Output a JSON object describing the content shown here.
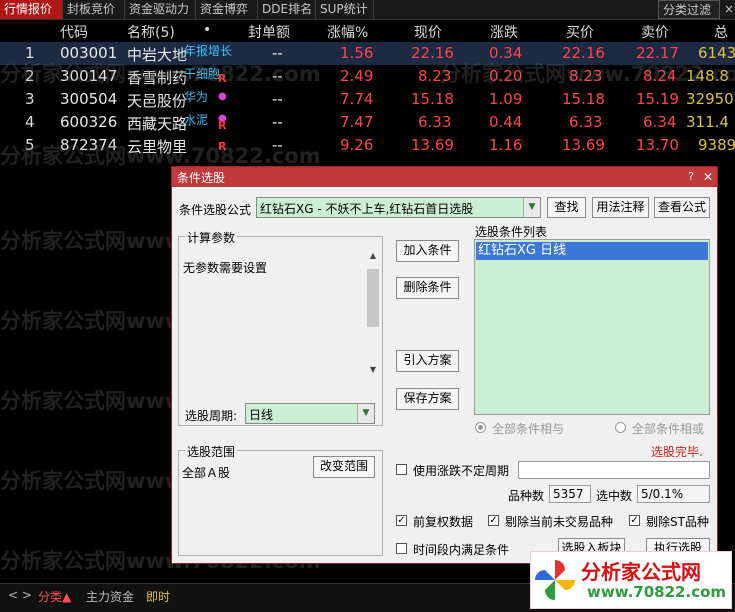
{
  "top_tabs": [
    "行情报价",
    "封板竞价",
    "资金驱动力",
    "资金博弈",
    "DDE排名",
    "SUP统计"
  ],
  "filter_button": "分类过滤",
  "columns": [
    "代码",
    "名称(5)",
    "•",
    "封单额",
    "涨幅%",
    "现价",
    "涨跌",
    "买价",
    "卖价",
    "总"
  ],
  "rows": [
    {
      "idx": "1",
      "code": "003001",
      "name": "中岩大地",
      "tag": "年报增长",
      "sealed": "--",
      "pct": "1.56",
      "price": "22.16",
      "chg": "0.34",
      "bid": "22.16",
      "ask": "22.17",
      "total": "6143",
      "r": ""
    },
    {
      "idx": "2",
      "code": "300147",
      "name": "香雪制药",
      "tag": "干细胞",
      "sealed": "--",
      "pct": "2.49",
      "price": "8.23",
      "chg": "0.20",
      "bid": "8.23",
      "ask": "8.24",
      "total": "148.8",
      "r": "R"
    },
    {
      "idx": "3",
      "code": "300504",
      "name": "天邑股份",
      "tag": "华为",
      "sealed": "--",
      "pct": "7.74",
      "price": "15.18",
      "chg": "1.09",
      "bid": "15.18",
      "ask": "15.19",
      "total": "32950",
      "r": ""
    },
    {
      "idx": "4",
      "code": "600326",
      "name": "西藏天路",
      "tag": "水泥",
      "sealed": "--",
      "pct": "7.47",
      "price": "6.33",
      "chg": "0.44",
      "bid": "6.33",
      "ask": "6.34",
      "total": "311.4",
      "r": "R"
    },
    {
      "idx": "5",
      "code": "872374",
      "name": "云里物里",
      "tag": "",
      "sealed": "--",
      "pct": "9.26",
      "price": "13.69",
      "chg": "1.16",
      "bid": "13.69",
      "ask": "13.70",
      "total": "9389",
      "r": "R"
    }
  ],
  "watermark_text": "分析家公式网www.70822.com",
  "dialog": {
    "title": "条件选股",
    "formula_label": "条件选股公式",
    "formula_value": "红钻石XG  -  不妖不上车,红钻石首日选股",
    "find_btn": "查找",
    "usage_btn": "用法注释",
    "view_btn": "查看公式",
    "calc_params": "计算参数",
    "no_params": "无参数需要设置",
    "period_label": "选股周期:",
    "period_value": "日线",
    "add_btn": "加入条件",
    "del_btn": "删除条件",
    "import_btn": "引入方案",
    "save_btn": "保存方案",
    "list_title": "选股条件列表",
    "list_items": [
      "红钻石XG  日线"
    ],
    "and_label": "全部条件相与",
    "or_label": "全部条件相或",
    "done_text": "选股完毕.",
    "range_title": "选股范围",
    "range_value": "全部Ａ股",
    "change_range_btn": "改变范围",
    "use_period_label": "使用涨跌不定周期",
    "count_label": "品种数",
    "count_value": "5357",
    "hit_label": "选中数",
    "hit_value": "5/0.1%",
    "fq_label": "前复权数据",
    "rm_untraded_label": "剔除当前未交易品种",
    "rm_st_label": "剔除ST品种",
    "time_label": "时间段内满足条件",
    "to_block_btn": "选股入板块",
    "exec_btn": "执行选股"
  },
  "bottom": {
    "nav": "< >",
    "category": "分类▲",
    "main_funds": "主力资金",
    "instant": "即时"
  },
  "logo": {
    "title": "分析家公式网",
    "url": "www.70822.com"
  }
}
